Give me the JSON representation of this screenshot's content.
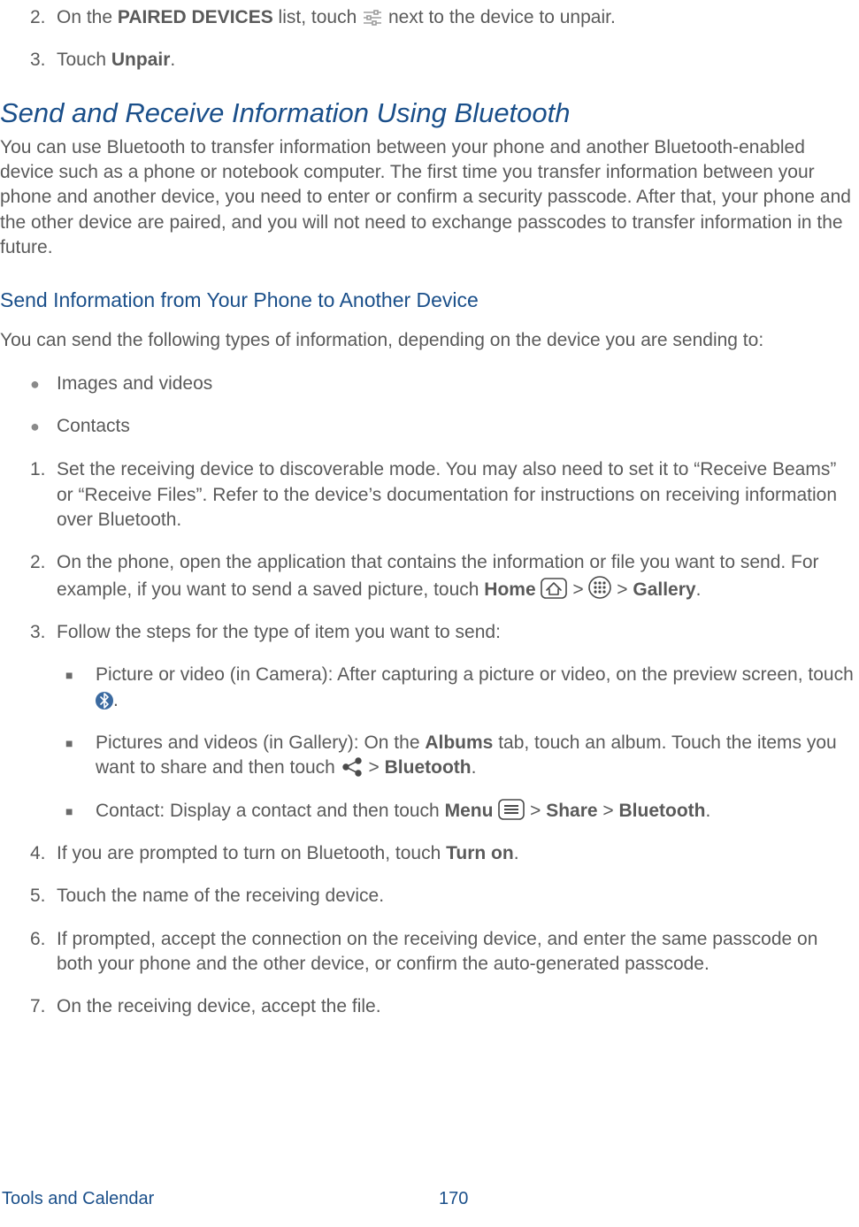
{
  "steps_a": {
    "n2": "2.",
    "t2_a": "On the ",
    "t2_b": "PAIRED DEVICES",
    "t2_c": " list, touch ",
    "t2_d": " next to the device to unpair.",
    "n3": "3.",
    "t3_a": "Touch ",
    "t3_b": "Unpair",
    "t3_c": "."
  },
  "h2": "Send and Receive Information Using Bluetooth",
  "p1": "You can use Bluetooth to transfer information between your phone and another Bluetooth-enabled device such as a phone or notebook computer. The first time you transfer information between your phone and another device, you need to enter or confirm a security passcode. After that, your phone and the other device are paired, and you will not need to exchange passcodes to transfer information in the future.",
  "h3": "Send Information from Your Phone to Another Device",
  "p2": "You can send the following types of information, depending on the device you are sending to:",
  "ul1": {
    "b1": "Images and videos",
    "b2": "Contacts"
  },
  "steps_b": {
    "n1": "1.",
    "t1": "Set the receiving device to discoverable mode. You may also need to set it to “Receive Beams” or “Receive Files”. Refer to the device’s documentation for instructions on receiving information over Bluetooth.",
    "n2": "2.",
    "t2_a": "On the phone, open the application that contains the information or file you want to send. For example, if you want to send a saved picture, touch ",
    "t2_b": "Home",
    "t2_c": " > ",
    "t2_d": " > ",
    "t2_e": "Gallery",
    "t2_f": ".",
    "n3": "3.",
    "t3": "Follow the steps for the type of item you want to send:",
    "sub_a_1": "Picture or video (in Camera): After capturing a picture or video, on the preview screen, touch ",
    "sub_a_2": ".",
    "sub_b_1": "Pictures and videos (in Gallery): On the ",
    "sub_b_2": "Albums",
    "sub_b_3": " tab, touch an album. Touch the items you want to share and then touch ",
    "sub_b_4": " > ",
    "sub_b_5": "Bluetooth",
    "sub_b_6": ".",
    "sub_c_1": "Contact: Display a contact and then touch ",
    "sub_c_2": "Menu",
    "sub_c_3": " > ",
    "sub_c_4": "Share",
    "sub_c_5": " > ",
    "sub_c_6": "Bluetooth",
    "sub_c_7": ".",
    "n4": "4.",
    "t4_a": "If you are prompted to turn on Bluetooth, touch ",
    "t4_b": "Turn on",
    "t4_c": ".",
    "n5": "5.",
    "t5": "Touch the name of the receiving device.",
    "n6": "6.",
    "t6": "If prompted, accept the connection on the receiving device, and enter the same passcode on both your phone and the other device, or confirm the auto-generated passcode.",
    "n7": "7.",
    "t7": "On the receiving device, accept the file."
  },
  "footer": {
    "section": "Tools and Calendar",
    "page": "170"
  }
}
